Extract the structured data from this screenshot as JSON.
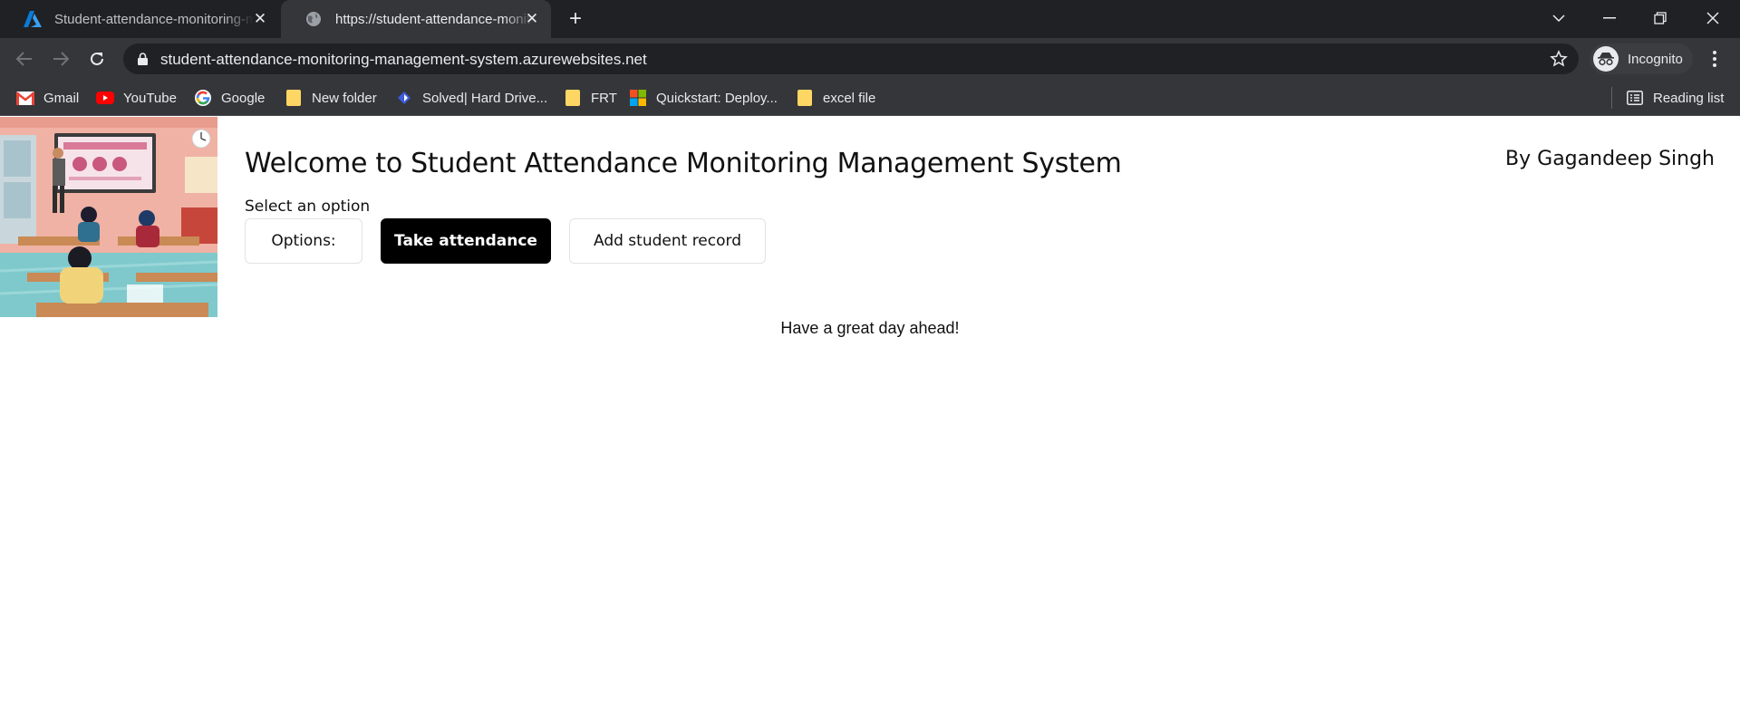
{
  "browser": {
    "tabs": [
      {
        "title": "Student-attendance-monitoring-management-system - Microsoft Azure",
        "active": false
      },
      {
        "title": "https://student-attendance-monitoring-management-system.azurewebsites.net",
        "active": true
      }
    ],
    "address": "student-attendance-monitoring-management-system.azurewebsites.net",
    "profile_label": "Incognito",
    "bookmarks": [
      {
        "label": "Gmail",
        "icon": "gmail-icon"
      },
      {
        "label": "YouTube",
        "icon": "youtube-icon"
      },
      {
        "label": "Google",
        "icon": "google-icon"
      },
      {
        "label": "New folder",
        "icon": "folder-icon"
      },
      {
        "label": "Solved| Hard Drive...",
        "icon": "site-icon"
      },
      {
        "label": "FRT",
        "icon": "folder-icon"
      },
      {
        "label": "Quickstart: Deploy...",
        "icon": "microsoft-icon"
      },
      {
        "label": "excel file",
        "icon": "folder-icon"
      }
    ],
    "reading_list_label": "Reading list"
  },
  "page": {
    "heading": "Welcome to Student Attendance Monitoring Management System",
    "author": "By Gagandeep Singh",
    "select_label": "Select an option",
    "buttons": {
      "options": "Options:",
      "take_attendance": "Take attendance",
      "add_record": "Add student record"
    },
    "greeting": "Have a great day ahead!"
  },
  "colors": {
    "chrome_dark": "#202124",
    "chrome_toolbar": "#35363a",
    "primary_button": "#000000",
    "folder": "#fdd663"
  }
}
